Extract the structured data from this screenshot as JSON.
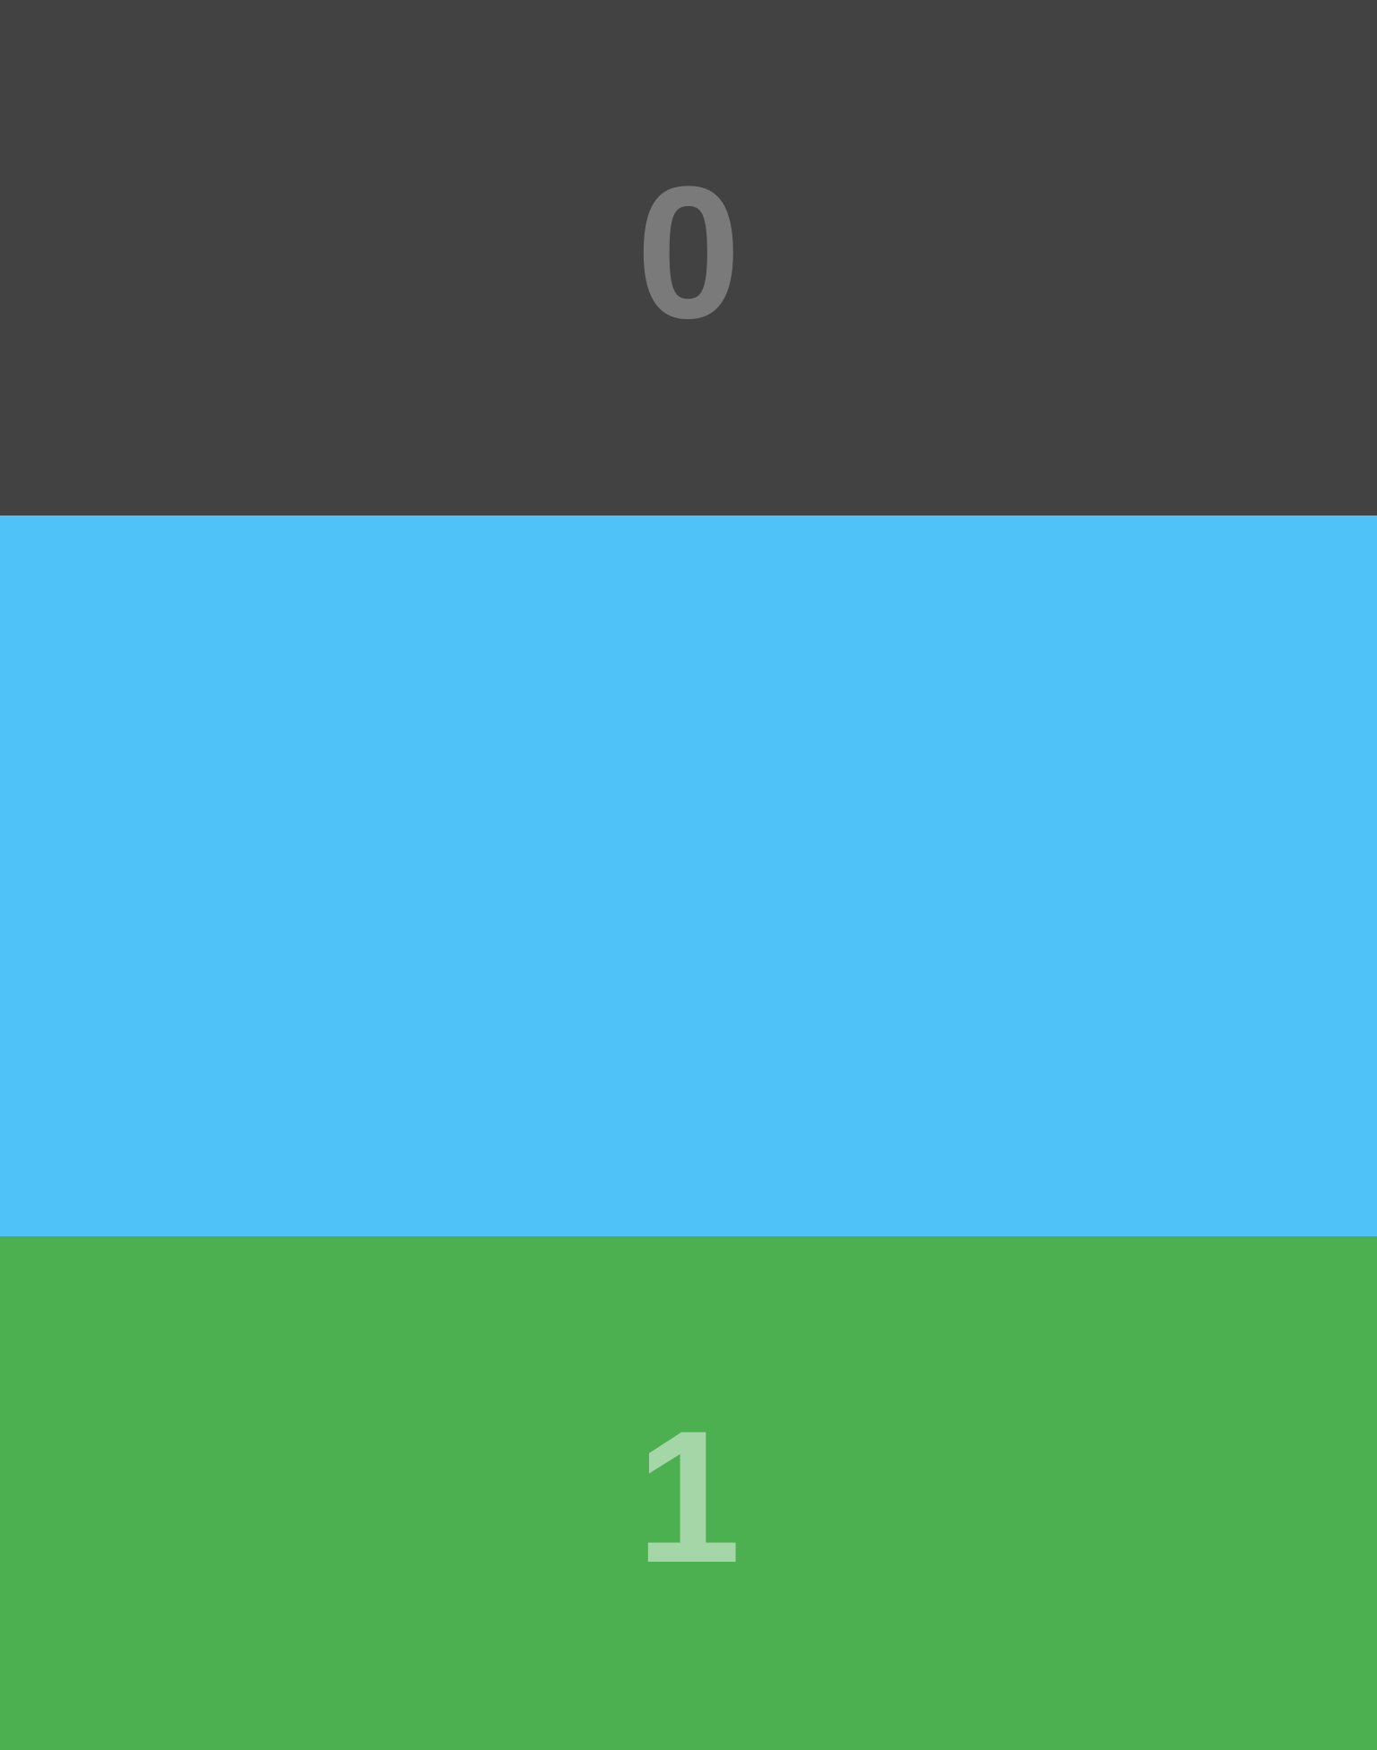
{
  "pages": [
    {
      "label": "0",
      "background": "#424242",
      "text_color": "#7a7a7a"
    },
    {
      "label": "",
      "background": "#4fc3f7"
    },
    {
      "label": "1",
      "background": "#4caf50",
      "text_color": "#a5d6a7"
    }
  ]
}
